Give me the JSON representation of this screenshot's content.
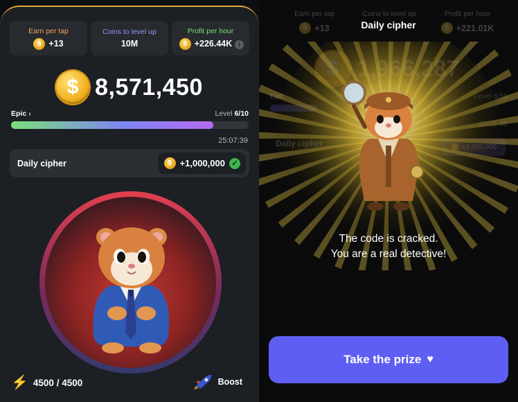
{
  "left": {
    "stats": [
      {
        "label": "Earn per tap",
        "value": "+13",
        "label_color": "#f5a25c"
      },
      {
        "label": "Coins to level up",
        "value": "10M",
        "label_color": "#8f9af0"
      },
      {
        "label": "Profit per hour",
        "value": "+226.44K",
        "label_color": "#7fe07a"
      }
    ],
    "balance": "8,571,450",
    "level": {
      "name": "Epic",
      "label": "Level",
      "value": "6/10",
      "progress": 0.85
    },
    "timer": "25:07:39",
    "cipher": {
      "label": "Daily cipher",
      "reward": "+1,000,000"
    },
    "energy": "4500 / 4500",
    "boost_label": "Boost"
  },
  "right": {
    "ghost": {
      "stats": [
        {
          "label": "Earn per tap",
          "value": "+13"
        },
        {
          "label": "Coins to level up",
          "value": ""
        },
        {
          "label": "Profit per hour",
          "value": "+221.01K"
        }
      ],
      "balance": "1,966,287",
      "level_name": "Epic",
      "level_value": "Level 6/10",
      "timer": "20:09:48",
      "cipher_label": "Daily cipher",
      "cipher_reward": "+1,000,000"
    },
    "modal_title": "Daily cipher",
    "message_line1": "The code is cracked.",
    "message_line2": "You are a real detective!",
    "button_label": "Take the prize"
  },
  "colors": {
    "accent": "#5f5ef2",
    "gold": "#f0b21f",
    "check": "#3fb34f"
  }
}
